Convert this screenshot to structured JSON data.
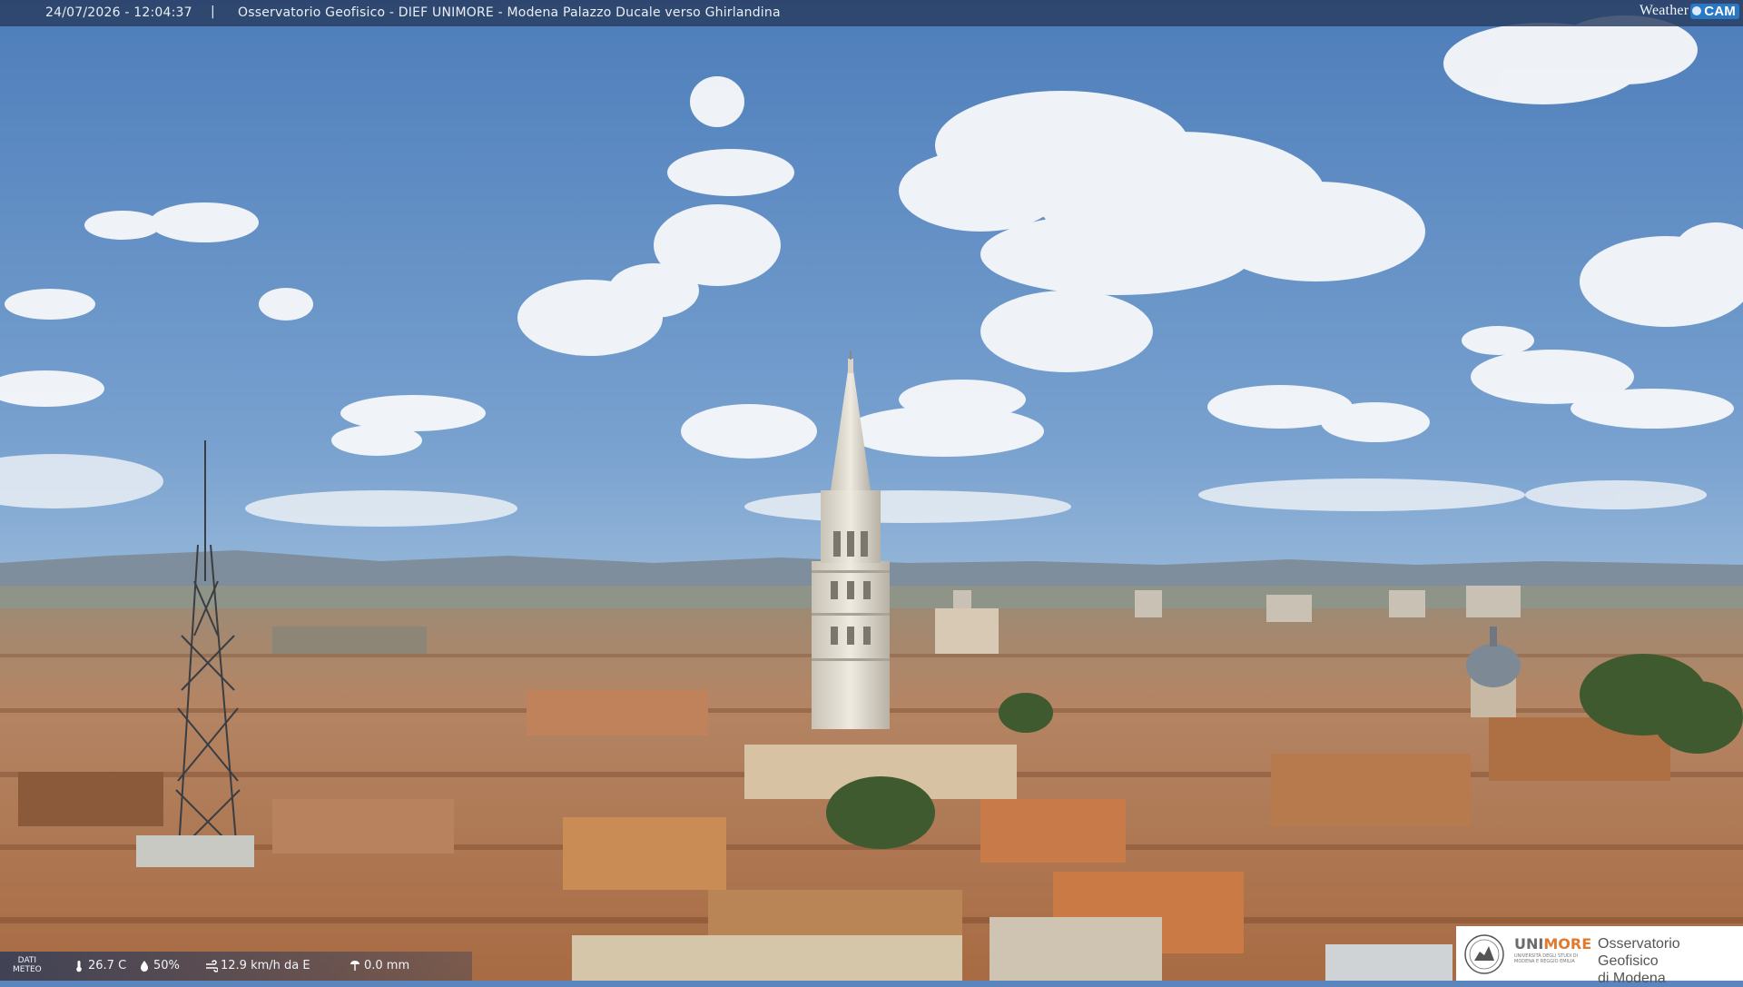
{
  "header": {
    "datetime": "24/07/2026 - 12:04:37",
    "separator": "|",
    "title": "Osservatorio Geofisico - DIEF UNIMORE - Modena Palazzo Ducale verso Ghirlandina"
  },
  "brand": {
    "weather": "Weather",
    "cam": "CAM"
  },
  "meteo": {
    "label_line1": "DATI",
    "label_line2": "METEO",
    "temperature": "26.7 C",
    "humidity": "50%",
    "wind": "12.9 km/h da E",
    "rain": "0.0 mm"
  },
  "logo": {
    "uni_part1": "UNI",
    "uni_part2": "MORE",
    "uni_sub": "Università degli studi di Modena e Reggio Emilia",
    "obs_line1": "Osservatorio Geofisico",
    "obs_line2": "di Modena"
  },
  "colors": {
    "sky_top": "#4f7fbb",
    "sky_bottom": "#c9dcea",
    "roof": "#b97a4c",
    "tower": "#e6e1d6",
    "bar": "#2c3f60",
    "unimore_orange": "#e07a2e"
  },
  "icons": {
    "temperature": "thermometer-icon",
    "humidity": "droplet-icon",
    "wind": "wind-icon",
    "rain": "rain-gauge-icon"
  }
}
